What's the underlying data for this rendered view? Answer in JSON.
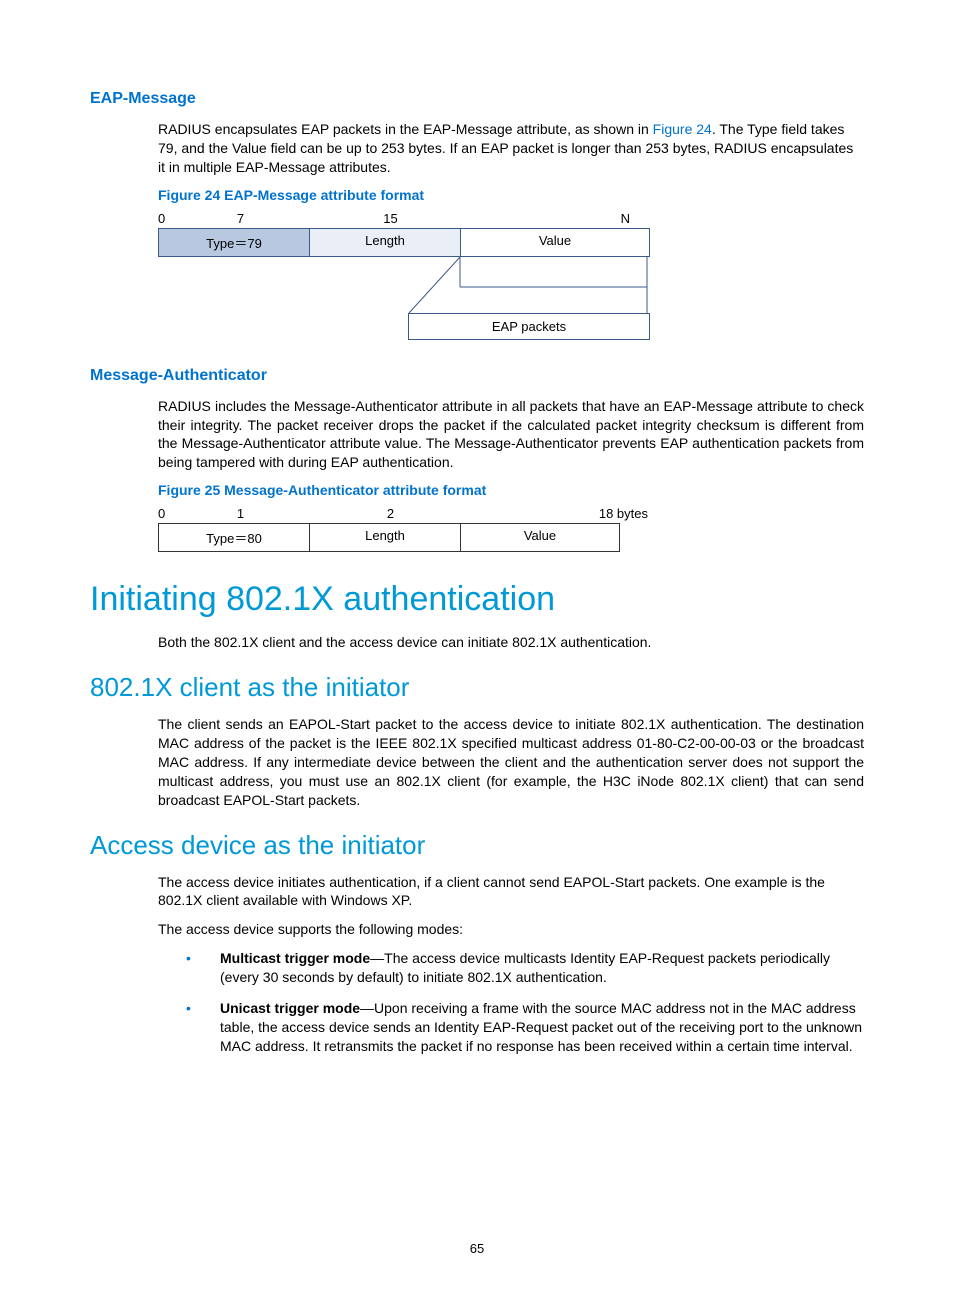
{
  "section1": {
    "heading": "EAP-Message",
    "para_pre": "RADIUS encapsulates EAP packets in the EAP-Message attribute, as shown in ",
    "para_link": "Figure 24",
    "para_post": ". The Type field takes 79, and the Value field can be up to 253 bytes. If an EAP packet is longer than 253 bytes, RADIUS encapsulates it in multiple EAP-Message attributes.",
    "fig_caption": "Figure 24 EAP-Message attribute format",
    "scale": {
      "t0": "0",
      "t7": "7",
      "t15": "15",
      "tN": "N"
    },
    "row": {
      "type": "Type＝79",
      "length": "Length",
      "value": "Value"
    },
    "eap_box": "EAP packets"
  },
  "section2": {
    "heading": "Message-Authenticator",
    "para": "RADIUS includes the Message-Authenticator attribute in all packets that have an EAP-Message attribute to check their integrity. The packet receiver drops the packet if the calculated packet integrity checksum is different from the Message-Authenticator attribute value. The Message-Authenticator prevents EAP authentication packets from being tampered with during EAP authentication.",
    "fig_caption": "Figure 25 Message-Authenticator attribute format",
    "scale": {
      "t0": "0",
      "t1": "1",
      "t2": "2",
      "t18": "18 bytes"
    },
    "row": {
      "type": "Type＝80",
      "length": "Length",
      "value": "Value"
    }
  },
  "section3": {
    "h1": "Initiating 802.1X authentication",
    "intro": "Both the 802.1X client and the access device can initiate 802.1X authentication.",
    "sub1": {
      "h2": "802.1X client as the initiator",
      "para": "The client sends an EAPOL-Start packet to the access device to initiate 802.1X authentication. The destination MAC address of the packet is the IEEE 802.1X specified multicast address 01-80-C2-00-00-03 or the broadcast MAC address. If any intermediate device between the client and the authentication server does not support the multicast address, you must use an 802.1X client (for example, the H3C iNode 802.1X client) that can send broadcast EAPOL-Start packets."
    },
    "sub2": {
      "h2": "Access device as the initiator",
      "para1": "The access device initiates authentication, if a client cannot send EAPOL-Start packets. One example is the 802.1X client available with Windows XP.",
      "para2": "The access device supports the following modes:",
      "bullets": [
        {
          "bold": "Multicast trigger mode",
          "rest": "—The access device multicasts Identity EAP-Request packets periodically (every 30 seconds by default) to initiate 802.1X authentication."
        },
        {
          "bold": "Unicast trigger mode",
          "rest": "—Upon receiving a frame with the source MAC address not in the MAC address table, the access device sends an Identity EAP-Request packet out of the receiving port to the unknown MAC address. It retransmits the packet if no response has been received within a certain time interval."
        }
      ]
    }
  },
  "page_number": "65"
}
